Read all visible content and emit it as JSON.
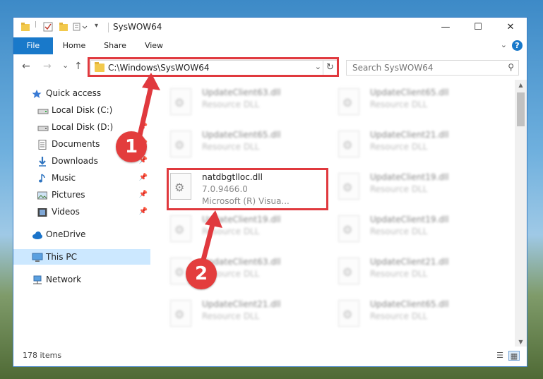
{
  "window": {
    "title": "SysWOW64",
    "controls": {
      "minimize": "—",
      "maximize": "☐",
      "close": "✕"
    }
  },
  "ribbon": {
    "tabs": [
      "File",
      "Home",
      "Share",
      "View"
    ],
    "collapse": "⌄",
    "help": "?"
  },
  "nav": {
    "back": "←",
    "forward": "→",
    "recent": "⌄",
    "up": "↑",
    "address": "C:\\Windows\\SysWOW64",
    "address_drop": "⌄",
    "refresh": "↻",
    "search_placeholder": "Search SysWOW64",
    "search_icon": "⚲"
  },
  "sidebar": {
    "items": [
      {
        "label": "Quick access",
        "icon": "star-icon"
      },
      {
        "label": "Local Disk (C:)",
        "icon": "drive-icon",
        "pinned": true
      },
      {
        "label": "Local Disk (D:)",
        "icon": "drive-icon",
        "pinned": true
      },
      {
        "label": "Documents",
        "icon": "documents-icon",
        "pinned": true
      },
      {
        "label": "Downloads",
        "icon": "downloads-icon",
        "pinned": true
      },
      {
        "label": "Music",
        "icon": "music-icon",
        "pinned": true
      },
      {
        "label": "Pictures",
        "icon": "pictures-icon",
        "pinned": true
      },
      {
        "label": "Videos",
        "icon": "videos-icon",
        "pinned": true
      },
      {
        "label": "OneDrive",
        "icon": "cloud-icon"
      },
      {
        "label": "This PC",
        "icon": "computer-icon",
        "selected": true
      },
      {
        "label": "Network",
        "icon": "network-icon"
      }
    ],
    "pin_glyph": "📌"
  },
  "files": [
    {
      "name": "UpdateClient63.dll",
      "type": "Resource DLL"
    },
    {
      "name": "UpdateClient65.dll",
      "type": "Resource DLL"
    },
    {
      "name": "UpdateClient65.dll",
      "type": "Resource DLL"
    },
    {
      "name": "UpdateClient21.dll",
      "type": "Resource DLL"
    },
    {
      "name": "natdbgtlloc.dll",
      "version": "7.0.9466.0",
      "company": "Microsoft (R) Visua...",
      "highlighted": true
    },
    {
      "name": "UpdateClient19.dll",
      "type": "Resource DLL"
    },
    {
      "name": "UpdateClient19.dll",
      "type": "Resource DLL"
    },
    {
      "name": "UpdateClient19.dll",
      "type": "Resource DLL"
    },
    {
      "name": "UpdateClient63.dll",
      "type": "Resource DLL"
    },
    {
      "name": "UpdateClient21.dll",
      "type": "Resource DLL"
    },
    {
      "name": "UpdateClient21.dll",
      "type": "Resource DLL"
    },
    {
      "name": "UpdateClient65.dll",
      "type": "Resource DLL"
    }
  ],
  "status": {
    "item_count": "178 items"
  },
  "annotations": {
    "step1": "1",
    "step2": "2",
    "color": "#e0393e"
  }
}
